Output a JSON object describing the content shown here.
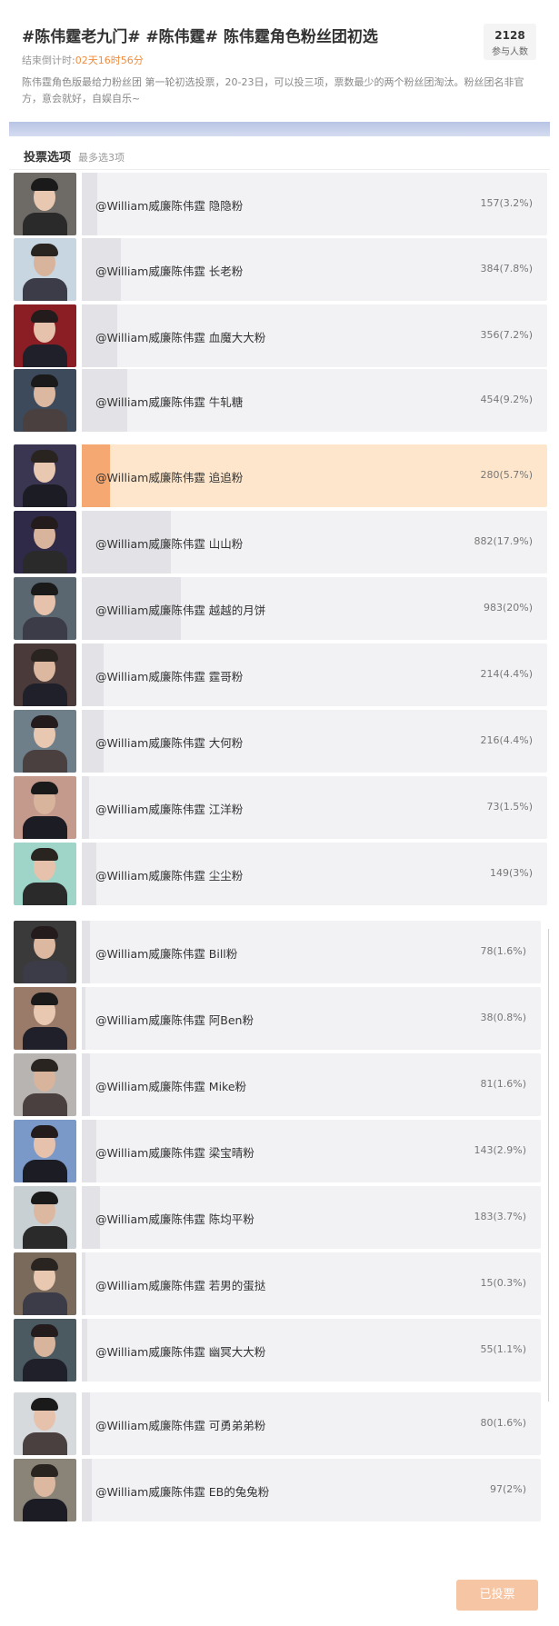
{
  "poll": {
    "title": "#陈伟霆老九门# #陈伟霆# 陈伟霆角色粉丝团初选",
    "countdown_label": "结束倒计时:",
    "countdown_value": "02天16时56分",
    "participants_count": "2128",
    "participants_label": "参与人数",
    "description": "陈伟霆角色版最给力粉丝团 第一轮初选投票，20-23日，可以投三项，票数最少的两个粉丝团淘汰。粉丝团名非官方，意会就好，自娱自乐~",
    "options_header": "投票选项",
    "options_hint": "最多选3项",
    "voted_button_label": "已投票"
  },
  "colors": {
    "accent": "#f08c3d",
    "selected_bg": "#fde6cc",
    "selected_fill": "#f6a873",
    "bar_bg": "#f2f2f5",
    "bar_fill": "#e3e3e7",
    "voted_button": "#f6c6a4"
  },
  "options": [
    {
      "name": "@William威廉陈伟霆 隐隐粉",
      "result": "157(3.2%)",
      "pct": 3.2,
      "selected": false
    },
    {
      "name": "@William威廉陈伟霆 长老粉",
      "result": "384(7.8%)",
      "pct": 7.8,
      "selected": false
    },
    {
      "name": "@William威廉陈伟霆 血魔大大粉",
      "result": "356(7.2%)",
      "pct": 7.2,
      "selected": false
    },
    {
      "name": "@William威廉陈伟霆 牛轧糖",
      "result": "454(9.2%)",
      "pct": 9.2,
      "selected": false
    },
    {
      "name": "@William威廉陈伟霆 追追粉",
      "result": "280(5.7%)",
      "pct": 5.7,
      "selected": true
    },
    {
      "name": "@William威廉陈伟霆 山山粉",
      "result": "882(17.9%)",
      "pct": 17.9,
      "selected": false
    },
    {
      "name": "@William威廉陈伟霆 越越的月饼",
      "result": "983(20%)",
      "pct": 20,
      "selected": false
    },
    {
      "name": "@William威廉陈伟霆 霆哥粉",
      "result": "214(4.4%)",
      "pct": 4.4,
      "selected": false
    },
    {
      "name": "@William威廉陈伟霆 大何粉",
      "result": "216(4.4%)",
      "pct": 4.4,
      "selected": false
    },
    {
      "name": "@William威廉陈伟霆 江洋粉",
      "result": "73(1.5%)",
      "pct": 1.5,
      "selected": false
    },
    {
      "name": "@William威廉陈伟霆 尘尘粉",
      "result": "149(3%)",
      "pct": 3,
      "selected": false
    },
    {
      "name": "@William威廉陈伟霆 Bill粉",
      "result": "78(1.6%)",
      "pct": 1.6,
      "selected": false
    },
    {
      "name": "@William威廉陈伟霆 阿Ben粉",
      "result": "38(0.8%)",
      "pct": 0.8,
      "selected": false
    },
    {
      "name": "@William威廉陈伟霆 Mike粉",
      "result": "81(1.6%)",
      "pct": 1.6,
      "selected": false
    },
    {
      "name": "@William威廉陈伟霆 梁宝晴粉",
      "result": "143(2.9%)",
      "pct": 2.9,
      "selected": false
    },
    {
      "name": "@William威廉陈伟霆 陈均平粉",
      "result": "183(3.7%)",
      "pct": 3.7,
      "selected": false
    },
    {
      "name": "@William威廉陈伟霆 若男的蛋挞",
      "result": "15(0.3%)",
      "pct": 0.3,
      "selected": false
    },
    {
      "name": "@William威廉陈伟霆 幽冥大大粉",
      "result": "55(1.1%)",
      "pct": 1.1,
      "selected": false
    },
    {
      "name": "@William威廉陈伟霆 可勇弟弟粉",
      "result": "80(1.6%)",
      "pct": 1.6,
      "selected": false
    },
    {
      "name": "@William威廉陈伟霆 EB的兔兔粉",
      "result": "97(2%)",
      "pct": 2,
      "selected": false
    }
  ]
}
